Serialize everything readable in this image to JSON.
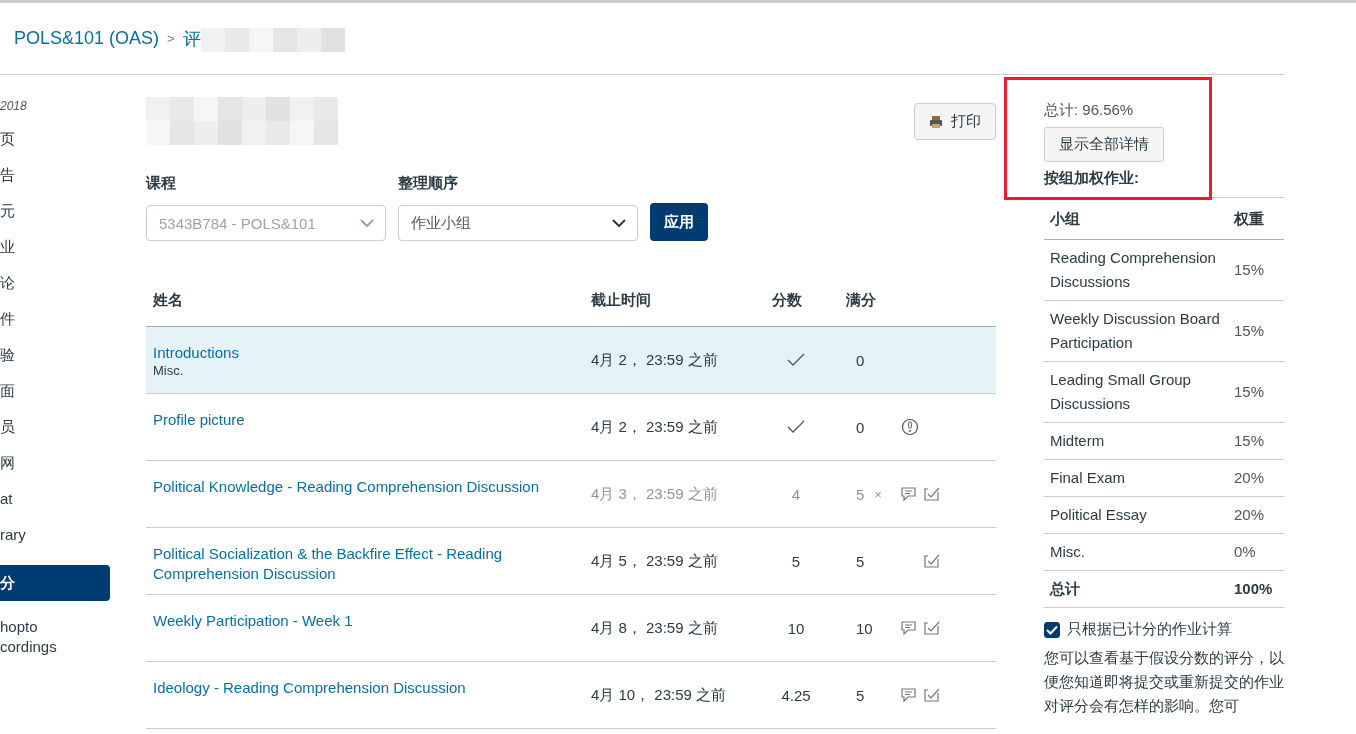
{
  "breadcrumb": {
    "course": "POLS&101 (OAS)",
    "separator": ">",
    "current": "评"
  },
  "sidebar": {
    "term": "2018",
    "items": [
      {
        "label": "页",
        "selected": false
      },
      {
        "label": "告",
        "selected": false
      },
      {
        "label": "元",
        "selected": false
      },
      {
        "label": "业",
        "selected": false
      },
      {
        "label": "论",
        "selected": false
      },
      {
        "label": "件",
        "selected": false
      },
      {
        "label": "验",
        "selected": false
      },
      {
        "label": "面",
        "selected": false
      },
      {
        "label": "员",
        "selected": false
      },
      {
        "label": "网",
        "selected": false
      },
      {
        "label": "at",
        "selected": false
      },
      {
        "label": "rary",
        "selected": false
      },
      {
        "label": "分",
        "selected": true
      },
      {
        "label": "hopto\ncordings",
        "selected": false
      }
    ]
  },
  "print_button": "打印",
  "filters": {
    "course_label": "课程",
    "course_value": "5343B784 - POLS&101",
    "order_label": "整理顺序",
    "order_value": "作业小组",
    "apply": "应用"
  },
  "table": {
    "columns": [
      "姓名",
      "截止时间",
      "分数",
      "满分"
    ],
    "rows": [
      {
        "name": "Introductions",
        "group": "Misc.",
        "due": "4月 2， 23:59 之前",
        "score": {
          "kind": "check"
        },
        "max": "0",
        "selected": true,
        "dimmed": false,
        "icons": []
      },
      {
        "name": "Profile picture",
        "due": "4月 2， 23:59 之前",
        "score": {
          "kind": "check"
        },
        "max": "0",
        "selected": false,
        "dimmed": false,
        "icons": [
          {
            "kind": "alert"
          }
        ]
      },
      {
        "name": "Political Knowledge - Reading Comprehension Discussion",
        "due": "4月 3， 23:59 之前",
        "score": {
          "kind": "text",
          "text": "4"
        },
        "max": "5",
        "x_mark": "×",
        "selected": false,
        "dimmed": true,
        "icons": [
          {
            "kind": "comment"
          },
          {
            "kind": "rubric"
          }
        ]
      },
      {
        "name": "Political Socialization & the Backfire Effect - Reading Comprehension Discussion",
        "due": "4月 5， 23:59 之前",
        "score": {
          "kind": "text",
          "text": "5"
        },
        "max": "5",
        "selected": false,
        "dimmed": false,
        "icons": [
          {
            "kind": "rubric"
          }
        ]
      },
      {
        "name": "Weekly Participation - Week 1",
        "due": "4月 8， 23:59 之前",
        "score": {
          "kind": "text",
          "text": "10"
        },
        "max": "10",
        "selected": false,
        "dimmed": false,
        "icons": [
          {
            "kind": "comment"
          },
          {
            "kind": "rubric"
          }
        ]
      },
      {
        "name": "Ideology - Reading Comprehension Discussion",
        "due": "4月 10， 23:59 之前",
        "score": {
          "kind": "text",
          "text": "4.25"
        },
        "max": "5",
        "selected": false,
        "dimmed": false,
        "icons": [
          {
            "kind": "comment"
          },
          {
            "kind": "rubric"
          }
        ]
      }
    ]
  },
  "summary": {
    "total": "总计: 96.56%",
    "show_all": "显示全部详情",
    "weighted_title": "按组加权作业:",
    "columns": [
      "小组",
      "权重"
    ],
    "groups": [
      {
        "name": "Reading Comprehension Discussions",
        "weight": "15%"
      },
      {
        "name": "Weekly Discussion Board Participation",
        "weight": "15%"
      },
      {
        "name": "Leading Small Group Discussions",
        "weight": "15%"
      },
      {
        "name": "Midterm",
        "weight": "15%"
      },
      {
        "name": "Final Exam",
        "weight": "20%"
      },
      {
        "name": "Political Essay",
        "weight": "20%"
      },
      {
        "name": "Misc.",
        "weight": "0%"
      }
    ],
    "total_row": {
      "name": "总计",
      "weight": "100%"
    },
    "graded_only": {
      "label": "只根据已计分的作业计算",
      "checked": true
    },
    "help": "您可以查看基于假设分数的评分，以便您知道即将提交或重新提交的作业对评分会有怎样的影响。您可"
  }
}
